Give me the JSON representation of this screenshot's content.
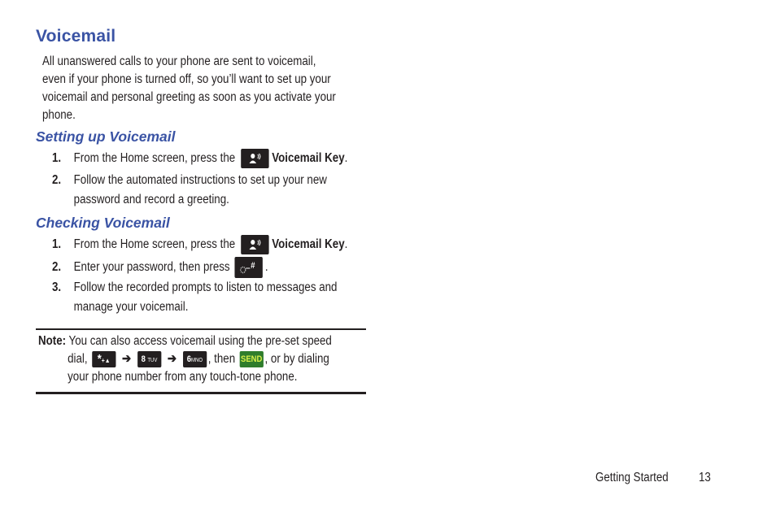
{
  "page": {
    "title": "Voicemail",
    "intro": {
      "lines": [
        "All unanswered calls to your phone are sent to voicemail,",
        "even if your phone is turned off, so you’ll want to set up your",
        "voicemail and personal greeting as soon as you activate your",
        "phone."
      ]
    },
    "sections": [
      {
        "heading": "Setting up Voicemail",
        "steps": [
          {
            "num": "1.",
            "text_before": "From the Home screen, press the",
            "icon": "voicemail-key-icon",
            "text_bold": "Voicemail Key",
            "text_after": "."
          },
          {
            "num": "2.",
            "line1": "Follow the automated instructions to set up your new",
            "line2": "password and record a greeting."
          }
        ]
      },
      {
        "heading": "Checking Voicemail",
        "steps": [
          {
            "num": "1.",
            "text_before": "From the Home screen, press the",
            "icon": "voicemail-key-icon",
            "text_bold": "Voicemail Key",
            "text_after": "."
          },
          {
            "num": "2.",
            "text_before": "Enter your password, then press",
            "icon": "pound-key-icon",
            "text_after": "."
          },
          {
            "num": "3.",
            "line1": "Follow the recorded prompts to listen to messages and",
            "line2": "manage your voicemail."
          }
        ]
      }
    ],
    "note": {
      "label": "Note:",
      "line1": "You can also access voicemail using the pre-set speed",
      "line2_prefix": "dial,",
      "keys": {
        "star": "*",
        "star_sub": "+▲",
        "eight": "8",
        "eight_sub": "TUV",
        "six": "6",
        "six_sub": "MNO",
        "send": "SEND"
      },
      "arrow": "➔",
      "then": ", then",
      "line2_suffix": ", or by dialing",
      "line3": "your phone number from any touch-tone phone."
    },
    "footer": {
      "section": "Getting Started",
      "page_number": "13"
    }
  }
}
